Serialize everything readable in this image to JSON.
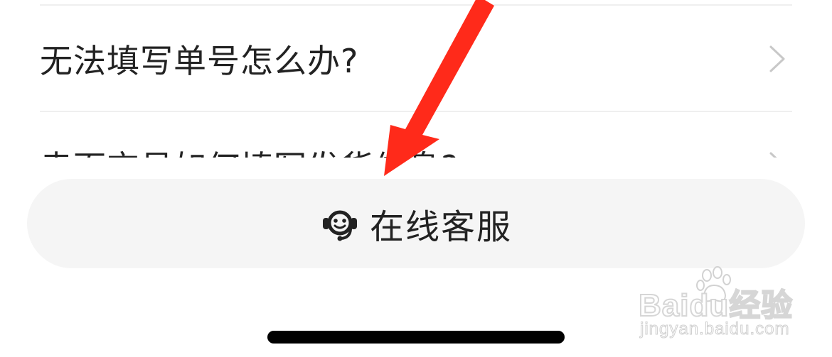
{
  "faq": {
    "items": [
      {
        "label": "无法填写单号怎么办?"
      },
      {
        "label": "卖面交易如何填写发货信息?"
      }
    ]
  },
  "customer_service": {
    "label": "在线客服",
    "icon": "headset-icon"
  },
  "watermark": {
    "brand": "Baidu经验",
    "url": "jingyan.baidu.com"
  },
  "colors": {
    "arrow": "#ff2a1a",
    "text": "#222222",
    "button_bg": "#f5f5f5",
    "divider": "#efefef",
    "chevron": "#c8c8c8"
  }
}
